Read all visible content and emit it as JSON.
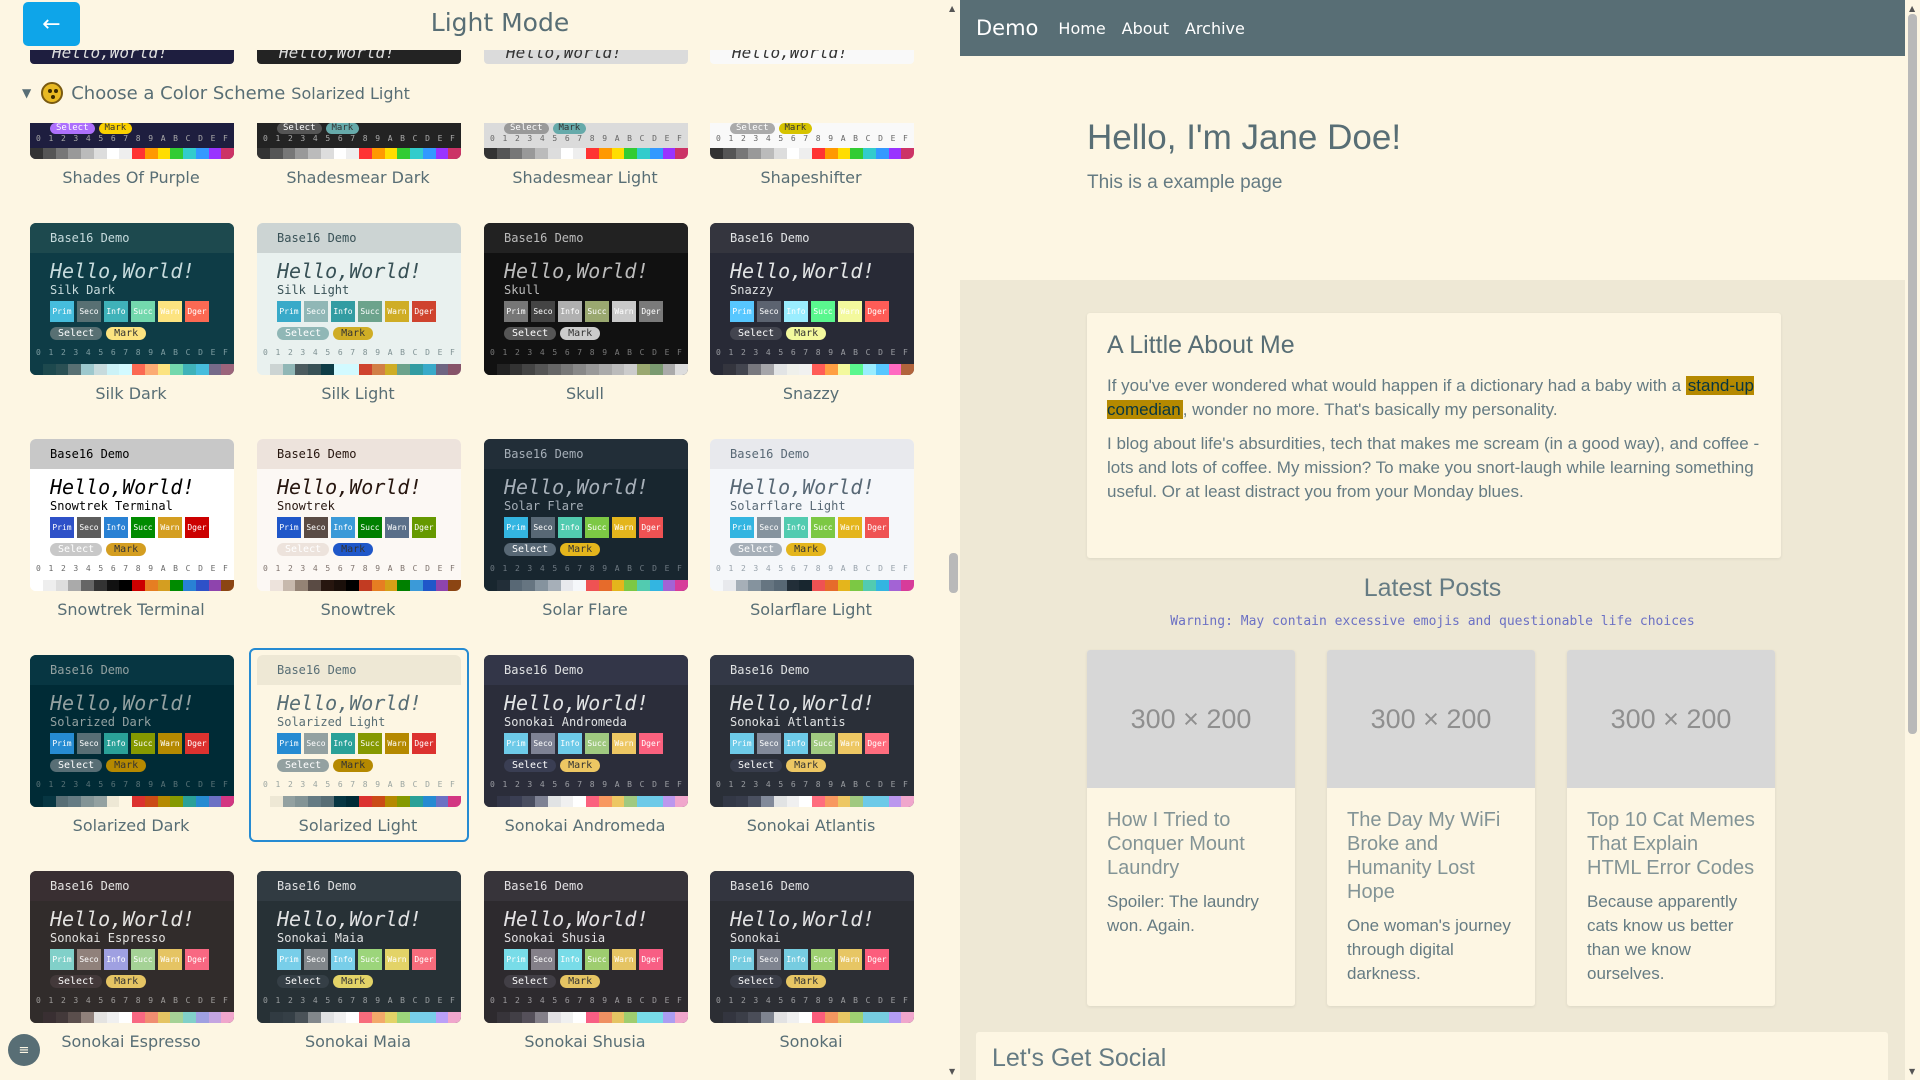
{
  "left": {
    "back_label": "←",
    "title": "Light Mode",
    "section_label": "Choose a Color Scheme",
    "selected_scheme": "Solarized Light",
    "menu_icon": "≡",
    "top_strip_text": "Hello,World!",
    "top_row": [
      {
        "label": "Shades Of Purple",
        "bg": "#1e1e3f",
        "sel_bg": "#ad70fc",
        "mark_bg": "#fad000"
      },
      {
        "label": "Shadesmear Dark",
        "bg": "#232323",
        "sel_bg": "#555",
        "mark_bg": "#6aa"
      },
      {
        "label": "Shadesmear Light",
        "bg": "#dbdbdb",
        "sel_bg": "#999",
        "mark_bg": "#6aa"
      },
      {
        "label": "Shapeshifter",
        "bg": "#f9f9f9",
        "sel_bg": "#aaa",
        "mark_bg": "#d6c300"
      }
    ],
    "card_header": "Base16 Demo",
    "card_hello": "Hello,World!",
    "swatch_labels": [
      "Prim",
      "Seco",
      "Info",
      "Succ",
      "Warn",
      "Dger"
    ],
    "select_label": "Select",
    "mark_label": "Mark",
    "digits": [
      "0",
      "1",
      "2",
      "3",
      "4",
      "5",
      "6",
      "7",
      "8",
      "9",
      "A",
      "B",
      "C",
      "D",
      "E",
      "F"
    ],
    "themes": [
      {
        "label": "Silk Dark",
        "name": "Silk Dark",
        "bg": "#0e3c46",
        "head": "#1d494e",
        "fg": "#c7dbdd",
        "sw": [
          "#46bddd",
          "#587073",
          "#3fb2b9",
          "#73d8ad",
          "#fce380",
          "#fb6953"
        ],
        "sel": "#587073",
        "mark": "#fce380",
        "bar": [
          "#0e3c46",
          "#1d494e",
          "#2a5054",
          "#587073",
          "#9dc8cd",
          "#c7dbdd",
          "#cbf2f7",
          "#d2faff",
          "#fb6953",
          "#fcab74",
          "#fce380",
          "#73d8ad",
          "#3fb2b9",
          "#46bddd",
          "#756b8a",
          "#9b647b"
        ]
      },
      {
        "label": "Silk Light",
        "name": "Silk Light",
        "bg": "#e9f1ef",
        "head": "#ccd4d3",
        "fg": "#385156",
        "sw": [
          "#39aac9",
          "#90b7b6",
          "#329ca2",
          "#6ca38c",
          "#cfad25",
          "#cf432e"
        ],
        "sel": "#90b7b6",
        "mark": "#cfad25",
        "bar": [
          "#e9f1ef",
          "#ccd4d3",
          "#90b7b6",
          "#4b5b5f",
          "#385156",
          "#0e3c46",
          "#d2faff",
          "#d2faff",
          "#cf432e",
          "#d27f46",
          "#cfad25",
          "#6ca38c",
          "#329ca2",
          "#39aac9",
          "#6e6582",
          "#865369"
        ]
      },
      {
        "label": "Skull",
        "name": "Skull",
        "bg": "#111111",
        "head": "#222222",
        "fg": "#bbbbbb",
        "sw": [
          "#767676",
          "#444",
          "#b0b0b0",
          "#9aa870",
          "#c9c9c9",
          "#7a7a7a"
        ],
        "sel": "#555",
        "mark": "#ccc",
        "bar": [
          "#111",
          "#222",
          "#333",
          "#444",
          "#555",
          "#666",
          "#777",
          "#888",
          "#999",
          "#aaa",
          "#bbb",
          "#ccc",
          "#9aa870",
          "#7a9a70",
          "#aaa",
          "#ddd"
        ]
      },
      {
        "label": "Snazzy",
        "name": "Snazzy",
        "bg": "#282a36",
        "head": "#34353e",
        "fg": "#e2e4e5",
        "sw": [
          "#57c7ff",
          "#5c6370",
          "#9aedfe",
          "#5af78e",
          "#f3f99d",
          "#ff5c57"
        ],
        "sel": "#43454f",
        "mark": "#f3f99d",
        "bar": [
          "#282a36",
          "#34353e",
          "#43454f",
          "#78787e",
          "#a5a5a9",
          "#e2e4e5",
          "#eff0eb",
          "#f1f1f0",
          "#ff5c57",
          "#ff9f43",
          "#f3f99d",
          "#5af78e",
          "#9aedfe",
          "#57c7ff",
          "#ff6ac1",
          "#b2643c"
        ]
      },
      {
        "label": "Snowtrek Terminal",
        "name": "Snowtrek Terminal",
        "bg": "#ffffff",
        "head": "#c8c8c8",
        "fg": "#000000",
        "sw": [
          "#2e51c8",
          "#5d5d5d",
          "#2981d4",
          "#008b00",
          "#d49e21",
          "#cc0000"
        ],
        "sel": "#c8c8c8",
        "mark": "#d49e21",
        "bar": [
          "#fff",
          "#eee",
          "#ddd",
          "#aaa",
          "#666",
          "#333",
          "#111",
          "#000",
          "#c00",
          "#e67e22",
          "#d49e21",
          "#008b00",
          "#2981d4",
          "#2e51c8",
          "#8e44ad",
          "#8b4513"
        ]
      },
      {
        "label": "Snowtrek",
        "name": "Snowtrek",
        "bg": "#fcf8f4",
        "head": "#ede3dc",
        "fg": "#27160f",
        "sw": [
          "#1f57c9",
          "#5a4b44",
          "#3b9ad8",
          "#008000",
          "#5a6f89",
          "#669900"
        ],
        "sel": "#ede3dc",
        "mark": "#1f57c9",
        "bar": [
          "#fcf8f4",
          "#ede3dc",
          "#c7b9ad",
          "#948375",
          "#5a4b44",
          "#27160f",
          "#1a0f0a",
          "#000",
          "#c23b22",
          "#e67e22",
          "#d4a017",
          "#008000",
          "#3b9ad8",
          "#1f57c9",
          "#8e44ad",
          "#8b4513"
        ]
      },
      {
        "label": "Solar Flare",
        "name": "Solar Flare",
        "bg": "#18262f",
        "head": "#222e38",
        "fg": "#a6afb8",
        "sw": [
          "#33b5e1",
          "#586875",
          "#52cbb0",
          "#7cc844",
          "#e4b51c",
          "#ef5253"
        ],
        "sel": "#586875",
        "mark": "#e4b51c",
        "bar": [
          "#18262f",
          "#222e38",
          "#586875",
          "#667581",
          "#85939e",
          "#a6afb8",
          "#e8e9ed",
          "#f5f7fa",
          "#ef5253",
          "#e66b2b",
          "#e4b51c",
          "#7cc844",
          "#52cbb0",
          "#33b5e1",
          "#a363d5",
          "#d73c9a"
        ]
      },
      {
        "label": "Solarflare Light",
        "name": "Solarflare Light",
        "bg": "#f5f7fa",
        "head": "#e8e9ed",
        "fg": "#586875",
        "sw": [
          "#33b5e1",
          "#85939e",
          "#52cbb0",
          "#7cc844",
          "#e4b51c",
          "#ef5253"
        ],
        "sel": "#a6afb8",
        "mark": "#e4b51c",
        "bar": [
          "#f5f7fa",
          "#e8e9ed",
          "#a6afb8",
          "#85939e",
          "#667581",
          "#586875",
          "#222e38",
          "#18262f",
          "#ef5253",
          "#e66b2b",
          "#e4b51c",
          "#7cc844",
          "#52cbb0",
          "#33b5e1",
          "#a363d5",
          "#d73c9a"
        ]
      },
      {
        "label": "Solarized Dark",
        "name": "Solarized Dark",
        "bg": "#002b36",
        "head": "#073642",
        "fg": "#93a1a1",
        "sw": [
          "#268bd2",
          "#586e75",
          "#2aa198",
          "#859900",
          "#b58900",
          "#dc322f"
        ],
        "sel": "#586e75",
        "mark": "#b58900",
        "bar": [
          "#002b36",
          "#073642",
          "#586e75",
          "#657b83",
          "#839496",
          "#93a1a1",
          "#eee8d5",
          "#fdf6e3",
          "#dc322f",
          "#cb4b16",
          "#b58900",
          "#859900",
          "#2aa198",
          "#268bd2",
          "#6c71c4",
          "#d33682"
        ]
      },
      {
        "label": "Solarized Light",
        "name": "Solarized Light",
        "bg": "#fdf6e3",
        "head": "#eee8d5",
        "fg": "#586e75",
        "sw": [
          "#268bd2",
          "#93a1a1",
          "#2aa198",
          "#859900",
          "#b58900",
          "#dc322f"
        ],
        "sel": "#93a1a1",
        "mark": "#b58900",
        "bar": [
          "#fdf6e3",
          "#eee8d5",
          "#93a1a1",
          "#839496",
          "#657b83",
          "#586e75",
          "#073642",
          "#002b36",
          "#dc322f",
          "#cb4b16",
          "#b58900",
          "#859900",
          "#2aa198",
          "#268bd2",
          "#6c71c4",
          "#d33682"
        ]
      },
      {
        "label": "Sonokai Andromeda",
        "name": "Sonokai Andromeda",
        "bg": "#2b2d3a",
        "head": "#333648",
        "fg": "#e1e3e4",
        "sw": [
          "#6dcae8",
          "#7e8294",
          "#6dcae8",
          "#a0c980",
          "#edc763",
          "#fb617e"
        ],
        "sel": "#3a3e53",
        "mark": "#edc763",
        "bar": [
          "#2b2d3a",
          "#333648",
          "#3a3e53",
          "#4a4e60",
          "#7e8294",
          "#e1e3e4",
          "#f0f0f0",
          "#fff",
          "#fb617e",
          "#f89860",
          "#edc763",
          "#a0c980",
          "#6dcae8",
          "#6dcae8",
          "#bb97ee",
          "#f0a6cc"
        ]
      },
      {
        "label": "Sonokai Atlantis",
        "name": "Sonokai Atlantis",
        "bg": "#2a2f38",
        "head": "#333846",
        "fg": "#e1e3e4",
        "sw": [
          "#6dcae8",
          "#828a9a",
          "#6dcae8",
          "#a0c980",
          "#edc763",
          "#ff6d7e"
        ],
        "sel": "#373c4b",
        "mark": "#edc763",
        "bar": [
          "#2a2f38",
          "#333846",
          "#373c4b",
          "#4a5060",
          "#828a9a",
          "#e1e3e4",
          "#f0f0f0",
          "#fff",
          "#ff6d7e",
          "#f89860",
          "#edc763",
          "#a0c980",
          "#6dcae8",
          "#6dcae8",
          "#bb97ee",
          "#f0a6cc"
        ]
      },
      {
        "label": "Sonokai Espresso",
        "name": "Sonokai Espresso",
        "bg": "#312c2b",
        "head": "#392f32",
        "fg": "#e4e3e1",
        "sw": [
          "#81d0c9",
          "#90817b",
          "#9fa0e1",
          "#a5d296",
          "#e5c463",
          "#f86882"
        ],
        "sel": "#43393a",
        "mark": "#e5c463",
        "bar": [
          "#312c2b",
          "#392f32",
          "#43393a",
          "#5a4e4c",
          "#90817b",
          "#e4e3e1",
          "#f0f0f0",
          "#fff",
          "#f86882",
          "#f08d71",
          "#e5c463",
          "#a5d296",
          "#81d0c9",
          "#9fa0e1",
          "#c4a5e1",
          "#f0a6cc"
        ]
      },
      {
        "label": "Sonokai Maia",
        "name": "Sonokai Maia",
        "bg": "#273136",
        "head": "#313b42",
        "fg": "#e1e2e3",
        "sw": [
          "#78cee9",
          "#82878b",
          "#78cee9",
          "#9cd57b",
          "#e3d367",
          "#f76c7c"
        ],
        "sel": "#353f46",
        "mark": "#e3d367",
        "bar": [
          "#273136",
          "#313b42",
          "#353f46",
          "#4a5258",
          "#82878b",
          "#e1e2e3",
          "#f0f0f0",
          "#fff",
          "#f76c7c",
          "#f3a96a",
          "#e3d367",
          "#9cd57b",
          "#78cee9",
          "#78cee9",
          "#baa0f8",
          "#f0a6cc"
        ]
      },
      {
        "label": "Sonokai Shusia",
        "name": "Sonokai Shusia",
        "bg": "#2d2a2e",
        "head": "#37343a",
        "fg": "#e3e1e4",
        "sw": [
          "#78dce8",
          "#848089",
          "#78dce8",
          "#9ecd6f",
          "#e5c463",
          "#f85e84"
        ],
        "sel": "#423f46",
        "mark": "#e5c463",
        "bar": [
          "#2d2a2e",
          "#37343a",
          "#423f46",
          "#55505a",
          "#848089",
          "#e3e1e4",
          "#f0f0f0",
          "#fff",
          "#f85e84",
          "#ef9062",
          "#e5c463",
          "#9ecd6f",
          "#78dce8",
          "#78dce8",
          "#ab9df2",
          "#f0a6cc"
        ]
      },
      {
        "label": "Sonokai",
        "name": "Sonokai",
        "bg": "#2c2e34",
        "head": "#33353f",
        "fg": "#e2e2e3",
        "sw": [
          "#76cce0",
          "#7f8490",
          "#76cce0",
          "#9ed072",
          "#e7c664",
          "#fc5d7c"
        ],
        "sel": "#3b3e48",
        "mark": "#e7c664",
        "bar": [
          "#2c2e34",
          "#33353f",
          "#3b3e48",
          "#4a4d58",
          "#7f8490",
          "#e2e2e3",
          "#f0f0f0",
          "#fff",
          "#fc5d7c",
          "#f39660",
          "#e7c664",
          "#9ed072",
          "#76cce0",
          "#76cce0",
          "#b39df3",
          "#f0a6cc"
        ]
      }
    ]
  },
  "right": {
    "brand": "Demo",
    "nav": [
      "Home",
      "About",
      "Archive"
    ],
    "hero_title": "Hello, I'm Jane Doe!",
    "hero_sub": "This is a example page",
    "about_title": "A Little About Me",
    "about_p1_pre": "If you've ever wondered what would happen if a dictionary had a baby with a ",
    "about_p1_mark": "stand-up comedian",
    "about_p1_post": ", wonder no more. That's basically my personality.",
    "about_p2": "I blog about life's absurdities, tech that makes me scream (in a good way), and coffee - lots and lots of coffee. My mission? To make you snort-laugh while learning something useful. Or at least distract you from your Monday blues.",
    "posts_title": "Latest Posts",
    "posts_warning": "Warning: May contain excessive emojis and questionable life choices",
    "posts": [
      {
        "img": "300 × 200",
        "title": "How I Tried to Conquer Mount Laundry",
        "desc": "Spoiler: The laundry won. Again."
      },
      {
        "img": "300 × 200",
        "title": "The Day My WiFi Broke and Humanity Lost Hope",
        "desc": "One woman's journey through digital darkness."
      },
      {
        "img": "300 × 200",
        "title": "Top 10 Cat Memes That Explain HTML Error Codes",
        "desc": "Because apparently cats know us better than we know ourselves."
      }
    ],
    "social_title": "Let's Get Social"
  }
}
